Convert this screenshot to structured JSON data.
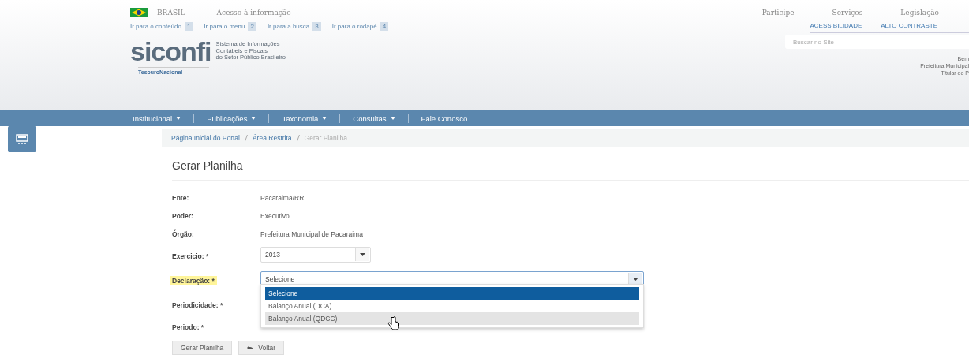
{
  "gov_bar": {
    "country": "BRASIL",
    "links": [
      "Acesso à informação"
    ],
    "right_links": [
      "Participe",
      "Serviços",
      "Legislação"
    ]
  },
  "skip_links": [
    {
      "label": "Ir para o conteúdo",
      "key": "1"
    },
    {
      "label": "Ir para o menu",
      "key": "2"
    },
    {
      "label": "Ir para a busca",
      "key": "3"
    },
    {
      "label": "Ir para o rodapé",
      "key": "4"
    }
  ],
  "accessibility_links": [
    "ACESSIBILIDADE",
    "ALTO CONTRASTE"
  ],
  "logo": {
    "name": "siconfi",
    "tagline": [
      "Sistema de Informações",
      "Contábeis e Fiscais",
      "do Setor Público Brasileiro"
    ],
    "org": "TesouroNacional"
  },
  "search": {
    "placeholder": "Buscar no Site"
  },
  "user_info": [
    "Bem",
    "Prefeitura Municipal",
    "Titular do P"
  ],
  "nav": [
    {
      "label": "Institucional",
      "dropdown": true
    },
    {
      "label": "Publicações",
      "dropdown": true
    },
    {
      "label": "Taxonomia",
      "dropdown": true
    },
    {
      "label": "Consultas",
      "dropdown": true
    },
    {
      "label": "Fale Conosco",
      "dropdown": false
    }
  ],
  "breadcrumb": [
    "Página Inicial do Portal",
    "Área Restrita",
    "Gerar Planilha"
  ],
  "page_title": "Gerar Planilha",
  "info": [
    {
      "label": "Ente:",
      "value": "Pacaraima/RR"
    },
    {
      "label": "Poder:",
      "value": "Executivo"
    },
    {
      "label": "Órgão:",
      "value": "Prefeitura Municipal de Pacaraima"
    }
  ],
  "fields": [
    {
      "label": "Exercicio: *",
      "value": "2013",
      "kind": "short",
      "highlighted": false,
      "expanded": false
    },
    {
      "label": "Declaração: *",
      "value": "Selecione",
      "kind": "wide",
      "highlighted": true,
      "expanded": true,
      "options": [
        {
          "label": "Selecione",
          "selected": true,
          "hovered": false
        },
        {
          "label": "Balanço Anual (DCA)",
          "selected": false,
          "hovered": false
        },
        {
          "label": "Balanço Anual (QDCC)",
          "selected": false,
          "hovered": true
        }
      ]
    },
    {
      "label": "Periodicidade: *",
      "kind": "hidden",
      "highlighted": false
    },
    {
      "label": "Periodo: *",
      "kind": "hidden",
      "highlighted": false
    }
  ],
  "buttons": [
    {
      "label": "Gerar Planilha",
      "icon": false
    },
    {
      "label": "Voltar",
      "icon": true
    }
  ]
}
